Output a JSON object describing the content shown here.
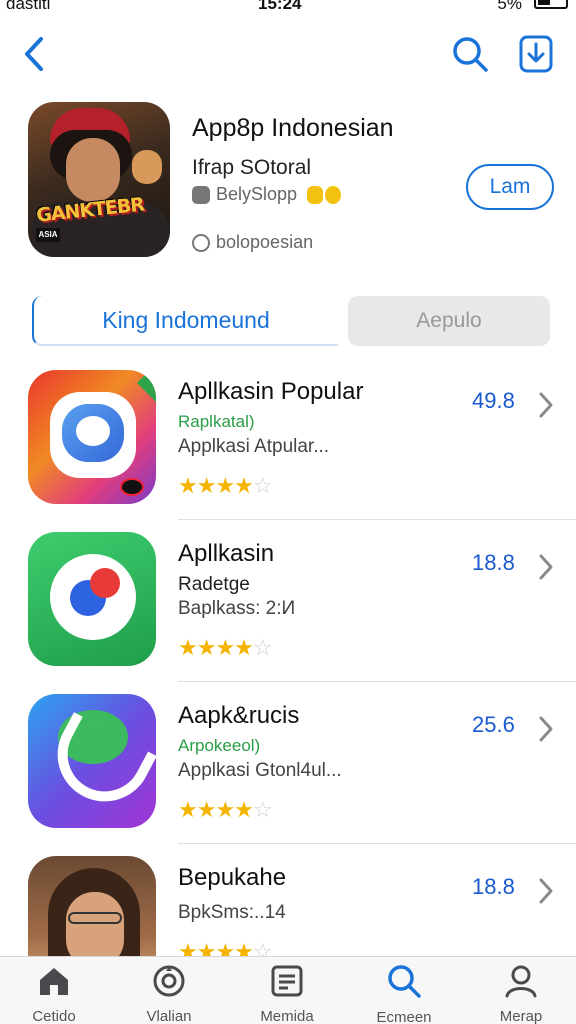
{
  "status_bar": {
    "carrier": "dastiti",
    "time": "15:24",
    "battery": "5%"
  },
  "app": {
    "title": "App8p Indonesian",
    "subtitle": "Ifrap SOtoral",
    "developer": "BelySlopp",
    "category": "bolopoesian",
    "get_label": "Lam",
    "icon_text": "GANKTEBR",
    "icon_logo": "ASIA"
  },
  "segments": {
    "active": "King  Indomeund",
    "inactive": "Aepulo"
  },
  "list": [
    {
      "name": "Apllkasin Popular",
      "sub": "Raplkatal)",
      "desc": "Applkasi Atpular...",
      "rating": "49.8",
      "stars_full": "★★★★",
      "stars_empty": "☆",
      "stars_value": 4.5
    },
    {
      "name": "Apllkasin",
      "sub": "Radetge",
      "desc": "Baplkass: 2:И",
      "rating": "18.8",
      "stars_full": "★★★★",
      "stars_empty": "☆",
      "stars_value": 4.5
    },
    {
      "name": "Aapk&rucis",
      "sub": "Arpokeeol)",
      "desc": "Applkasi Gtonl4ul...",
      "rating": "25.6",
      "stars_full": "★★★★",
      "stars_empty": "☆",
      "stars_value": 4.5
    },
    {
      "name": "Bepukahe",
      "sub": "",
      "desc": "BpkSms:..14",
      "rating": "18.8",
      "stars_full": "★★★★",
      "stars_empty": "☆",
      "stars_value": 4.5
    }
  ],
  "tabs": [
    {
      "label": "Cetido",
      "icon": "home-icon"
    },
    {
      "label": "Vlalian",
      "icon": "refresh-icon"
    },
    {
      "label": "Memida",
      "icon": "document-icon"
    },
    {
      "label": "Ecmeen",
      "icon": "search-icon"
    },
    {
      "label": "Merap",
      "icon": "person-icon"
    }
  ],
  "colors": {
    "accent": "#1a73d9",
    "rating": "#1a5ad0",
    "star": "#f4b400",
    "green_sub": "#2a9d46"
  }
}
